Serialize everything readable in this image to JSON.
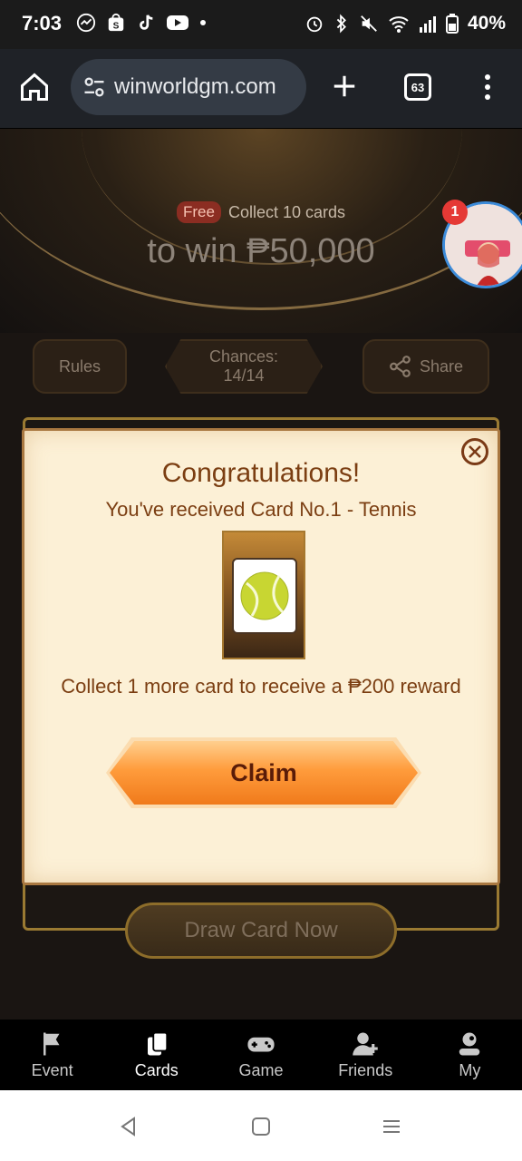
{
  "status_bar": {
    "time": "7:03",
    "battery": "40%",
    "left_icons": [
      "messenger-icon",
      "shopee-icon",
      "tiktok-icon",
      "youtube-icon",
      "dot-icon"
    ],
    "right_icons": [
      "alarm-icon",
      "bluetooth-icon",
      "mute-icon",
      "wifi-icon",
      "signal-icon",
      "battery-icon"
    ]
  },
  "browser": {
    "url": "winworldgm.com",
    "tab_count": "63"
  },
  "hero": {
    "free_badge": "Free",
    "collect_text": "Collect 10 cards",
    "win_text": "to win ₱50,000",
    "notification_count": "1"
  },
  "actions": {
    "rules": "Rules",
    "chances_label": "Chances:",
    "chances_value": "14/14",
    "share": "Share"
  },
  "modal": {
    "title": "Congratulations!",
    "subtitle": "You've received Card No.1 - Tennis",
    "reward_text": "Collect 1 more card to receive a ₱200 reward",
    "claim_label": "Claim"
  },
  "draw_button": "Draw Card Now",
  "bottom_nav": {
    "items": [
      {
        "label": "Event",
        "icon": "flag-icon"
      },
      {
        "label": "Cards",
        "icon": "cards-icon",
        "active": true
      },
      {
        "label": "Game",
        "icon": "gamepad-icon"
      },
      {
        "label": "Friends",
        "icon": "add-friend-icon"
      },
      {
        "label": "My",
        "icon": "profile-icon"
      }
    ]
  },
  "colors": {
    "accent_orange": "#ff9c3c",
    "modal_text": "#7b3e12",
    "gold_border": "#9a7a32"
  }
}
